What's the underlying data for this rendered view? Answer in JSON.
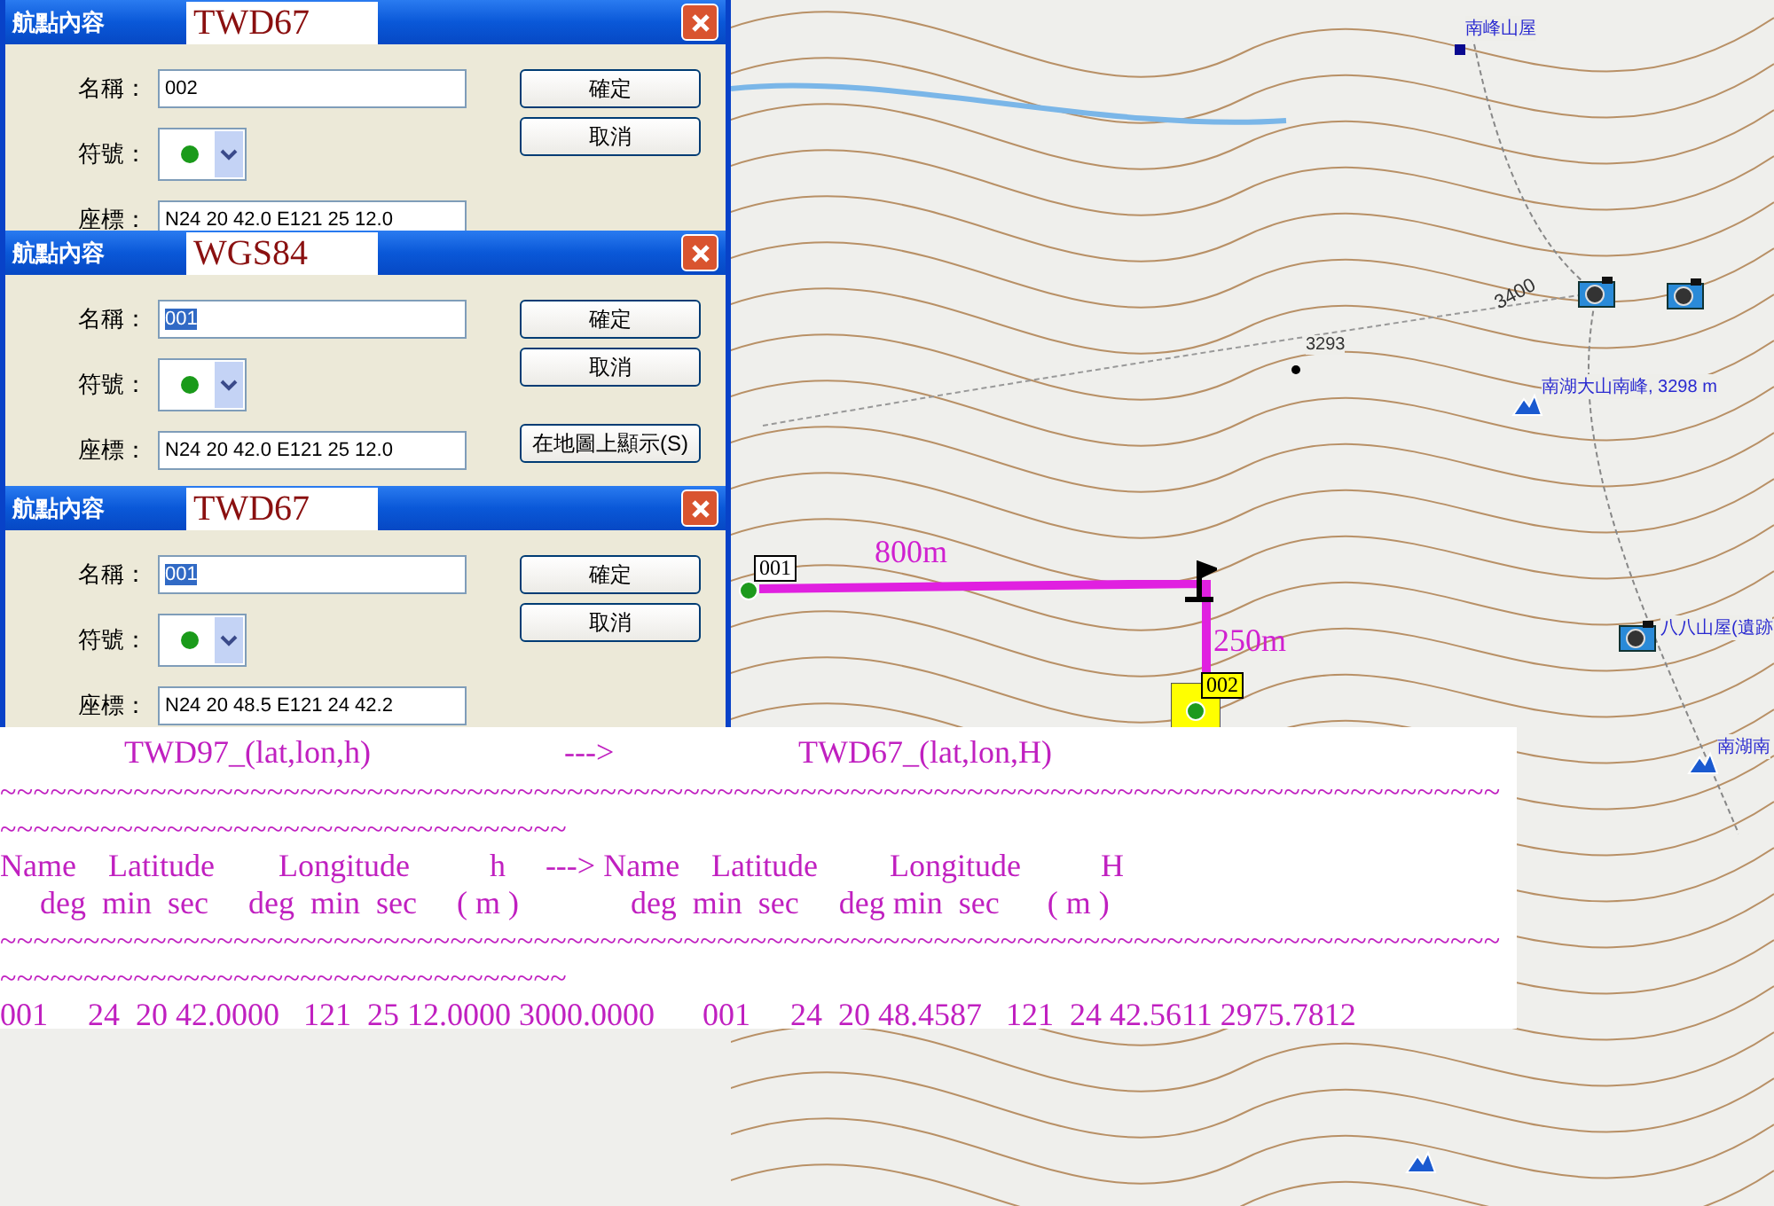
{
  "dialogs": [
    {
      "title": "航點內容",
      "datum": "TWD67",
      "name_label": "名稱：",
      "name": "002",
      "name_selected": false,
      "symbol_label": "符號：",
      "coord_label": "座標：",
      "coords": "N24 20 42.0 E121 25 12.0",
      "buttons": [
        "確定",
        "取消"
      ]
    },
    {
      "title": "航點內容",
      "datum": "WGS84",
      "name_label": "名稱：",
      "name": "001",
      "name_selected": true,
      "symbol_label": "符號：",
      "coord_label": "座標：",
      "coords": "N24 20 42.0 E121 25 12.0",
      "buttons": [
        "確定",
        "取消",
        "在地圖上顯示(S)"
      ]
    },
    {
      "title": "航點內容",
      "datum": "TWD67",
      "name_label": "名稱：",
      "name": "001",
      "name_selected": true,
      "symbol_label": "符號：",
      "coord_label": "座標：",
      "coords": "N24 20 48.5 E121 24 42.2",
      "buttons": [
        "確定",
        "取消"
      ]
    }
  ],
  "map": {
    "places": [
      {
        "kind": "hut",
        "label": "南峰山屋"
      },
      {
        "kind": "contour",
        "label": "3400"
      },
      {
        "kind": "point",
        "label": "3293"
      },
      {
        "kind": "peak",
        "label": "南湖大山南峰, 3298 m"
      },
      {
        "kind": "camera",
        "label": "八八山屋(遺跡"
      },
      {
        "kind": "peak",
        "label": "南湖南"
      }
    ],
    "route": {
      "start_label": "001",
      "end_label": "002",
      "leg_1": "800m",
      "leg_2": "250m"
    }
  },
  "conversion": {
    "heading": [
      "TWD97_(lat,lon,h)",
      "--->",
      "TWD67_(lat,lon,H)"
    ],
    "lines": [
      {
        "kind": "rule",
        "text": "~~~~~~~~~~~~~~~~~~~~~~~~~~~~~~~~~~~~~~~~~~~~~~~~~~~~~~~~~~~~~~~~~~~~~~~~~~~~~~~~~~~~~~~~~~"
      },
      {
        "kind": "rule",
        "text": "~~~~~~~~~~~~~~~~~~~~~~~~~~~~~~~~~~"
      },
      {
        "kind": "text",
        "text": "Name    Latitude        Longitude          h     ---> Name    Latitude         Longitude          H"
      },
      {
        "kind": "text",
        "text": "     deg  min  sec     deg  min  sec     ( m )              deg  min  sec     deg min  sec      ( m )"
      },
      {
        "kind": "rule",
        "text": "~~~~~~~~~~~~~~~~~~~~~~~~~~~~~~~~~~~~~~~~~~~~~~~~~~~~~~~~~~~~~~~~~~~~~~~~~~~~~~~~~~~~~~~~~~"
      },
      {
        "kind": "rule",
        "text": "~~~~~~~~~~~~~~~~~~~~~~~~~~~~~~~~~~"
      },
      {
        "kind": "text",
        "text": "001     24  20 42.0000   121  25 12.0000 3000.0000      001     24  20 48.4587   121  24 42.5611 2975.7812"
      }
    ]
  }
}
